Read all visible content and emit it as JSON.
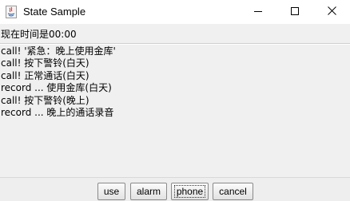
{
  "window": {
    "title": "State Sample",
    "controls": {
      "minimize": "minimize-icon",
      "maximize": "maximize-icon",
      "close": "close-icon"
    }
  },
  "status": {
    "label": "现在时间是00:00"
  },
  "log": {
    "lines": [
      "call! '紧急：晚上使用金库'",
      "call! 按下警铃(白天)",
      "call! 正常通话(白天)",
      "record ... 使用金库(白天)",
      "call! 按下警铃(晚上)",
      "record ... 晚上的通话录音"
    ]
  },
  "buttons": {
    "use": "use",
    "alarm": "alarm",
    "phone": "phone",
    "cancel": "cancel",
    "focused": "phone"
  },
  "colors": {
    "window_bg": "#f0f0f0",
    "titlebar_bg": "#ffffff",
    "text": "#000000"
  }
}
